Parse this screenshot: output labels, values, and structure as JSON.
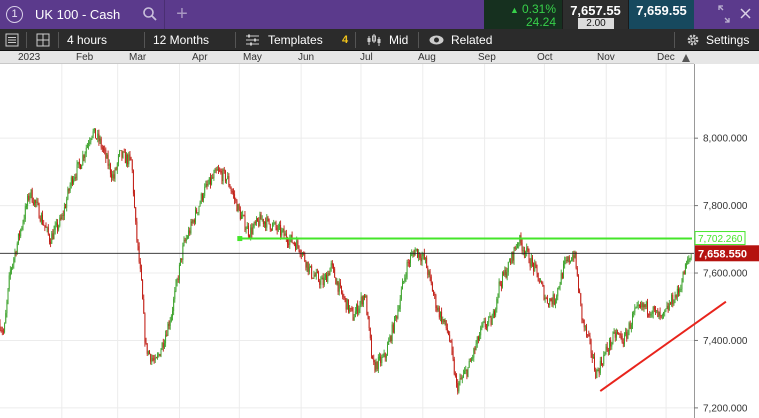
{
  "instrument": {
    "tab_number": "1",
    "name": "UK 100 - Cash"
  },
  "quote": {
    "change_pct": "0.31%",
    "change_abs": "24.24",
    "sell": "7,657.55",
    "buy": "7,659.55",
    "spread": "2.00"
  },
  "toolbar": {
    "interval": "4 hours",
    "range": "12 Months",
    "templates": "Templates",
    "indicator_count": "4",
    "price_type": "Mid",
    "related": "Related",
    "settings": "Settings"
  },
  "month_axis": {
    "year": "2023",
    "months": [
      "Feb",
      "Mar",
      "Apr",
      "May",
      "Jun",
      "Jul",
      "Aug",
      "Sep",
      "Oct",
      "Nov",
      "Dec"
    ]
  },
  "colors": {
    "up": "#3aa12a",
    "down": "#c01b12",
    "support_line": "#e8241c",
    "resistance_line": "#44e62a",
    "current_price_bg": "#b5120f"
  },
  "chart_data": {
    "type": "candlestick",
    "title": "UK 100 - Cash",
    "interval": "4 hours",
    "x_start": "2023-01-01",
    "x_end": "2023-12-15",
    "ylim": [
      7170,
      8220
    ],
    "yticks": [
      8000,
      7800,
      7600,
      7400,
      7200
    ],
    "ytick_labels": [
      "8,000.000",
      "7,800.000",
      "7,600.000",
      "7,400.000",
      "7,200.000"
    ],
    "grid": true,
    "path": [
      [
        "2023-01-01",
        7450
      ],
      [
        "2023-01-03",
        7420
      ],
      [
        "2023-01-06",
        7600
      ],
      [
        "2023-01-11",
        7720
      ],
      [
        "2023-01-16",
        7840
      ],
      [
        "2023-01-20",
        7790
      ],
      [
        "2023-01-26",
        7700
      ],
      [
        "2023-02-01",
        7760
      ],
      [
        "2023-02-06",
        7880
      ],
      [
        "2023-02-10",
        7920
      ],
      [
        "2023-02-16",
        8020
      ],
      [
        "2023-02-20",
        7990
      ],
      [
        "2023-02-27",
        7880
      ],
      [
        "2023-03-02",
        7950
      ],
      [
        "2023-03-08",
        7930
      ],
      [
        "2023-03-10",
        7740
      ],
      [
        "2023-03-13",
        7560
      ],
      [
        "2023-03-15",
        7380
      ],
      [
        "2023-03-20",
        7330
      ],
      [
        "2023-03-24",
        7400
      ],
      [
        "2023-03-28",
        7480
      ],
      [
        "2023-04-03",
        7680
      ],
      [
        "2023-04-07",
        7740
      ],
      [
        "2023-04-13",
        7840
      ],
      [
        "2023-04-20",
        7900
      ],
      [
        "2023-04-25",
        7880
      ],
      [
        "2023-05-01",
        7780
      ],
      [
        "2023-05-06",
        7720
      ],
      [
        "2023-05-12",
        7760
      ],
      [
        "2023-05-18",
        7740
      ],
      [
        "2023-05-24",
        7710
      ],
      [
        "2023-05-31",
        7680
      ],
      [
        "2023-06-06",
        7600
      ],
      [
        "2023-06-12",
        7570
      ],
      [
        "2023-06-16",
        7620
      ],
      [
        "2023-06-21",
        7540
      ],
      [
        "2023-06-27",
        7470
      ],
      [
        "2023-07-03",
        7540
      ],
      [
        "2023-07-07",
        7320
      ],
      [
        "2023-07-13",
        7350
      ],
      [
        "2023-07-19",
        7480
      ],
      [
        "2023-07-24",
        7620
      ],
      [
        "2023-07-28",
        7670
      ],
      [
        "2023-08-02",
        7640
      ],
      [
        "2023-08-08",
        7500
      ],
      [
        "2023-08-14",
        7420
      ],
      [
        "2023-08-18",
        7260
      ],
      [
        "2023-08-24",
        7320
      ],
      [
        "2023-08-31",
        7440
      ],
      [
        "2023-09-05",
        7460
      ],
      [
        "2023-09-08",
        7560
      ],
      [
        "2023-09-13",
        7620
      ],
      [
        "2023-09-18",
        7700
      ],
      [
        "2023-09-22",
        7660
      ],
      [
        "2023-09-27",
        7600
      ],
      [
        "2023-10-02",
        7520
      ],
      [
        "2023-10-06",
        7520
      ],
      [
        "2023-10-11",
        7620
      ],
      [
        "2023-10-16",
        7660
      ],
      [
        "2023-10-20",
        7460
      ],
      [
        "2023-10-24",
        7380
      ],
      [
        "2023-10-27",
        7300
      ],
      [
        "2023-11-01",
        7370
      ],
      [
        "2023-11-06",
        7420
      ],
      [
        "2023-11-10",
        7400
      ],
      [
        "2023-11-15",
        7480
      ],
      [
        "2023-11-20",
        7500
      ],
      [
        "2023-11-24",
        7490
      ],
      [
        "2023-11-29",
        7460
      ],
      [
        "2023-12-04",
        7520
      ],
      [
        "2023-12-07",
        7540
      ],
      [
        "2023-12-11",
        7620
      ],
      [
        "2023-12-14",
        7658
      ]
    ],
    "lines": [
      {
        "name": "resistance",
        "from": [
          "2023-05-01",
          7702.26
        ],
        "to": [
          "2023-12-14",
          7702.26
        ],
        "color": "#44e62a",
        "label": "7,702.260"
      },
      {
        "name": "support-trendline",
        "from": [
          "2023-10-29",
          7250
        ],
        "to": [
          "2023-12-31",
          7515
        ],
        "color": "#e8241c"
      }
    ],
    "current_price": {
      "value": 7658.55,
      "label": "7,658.550"
    }
  }
}
